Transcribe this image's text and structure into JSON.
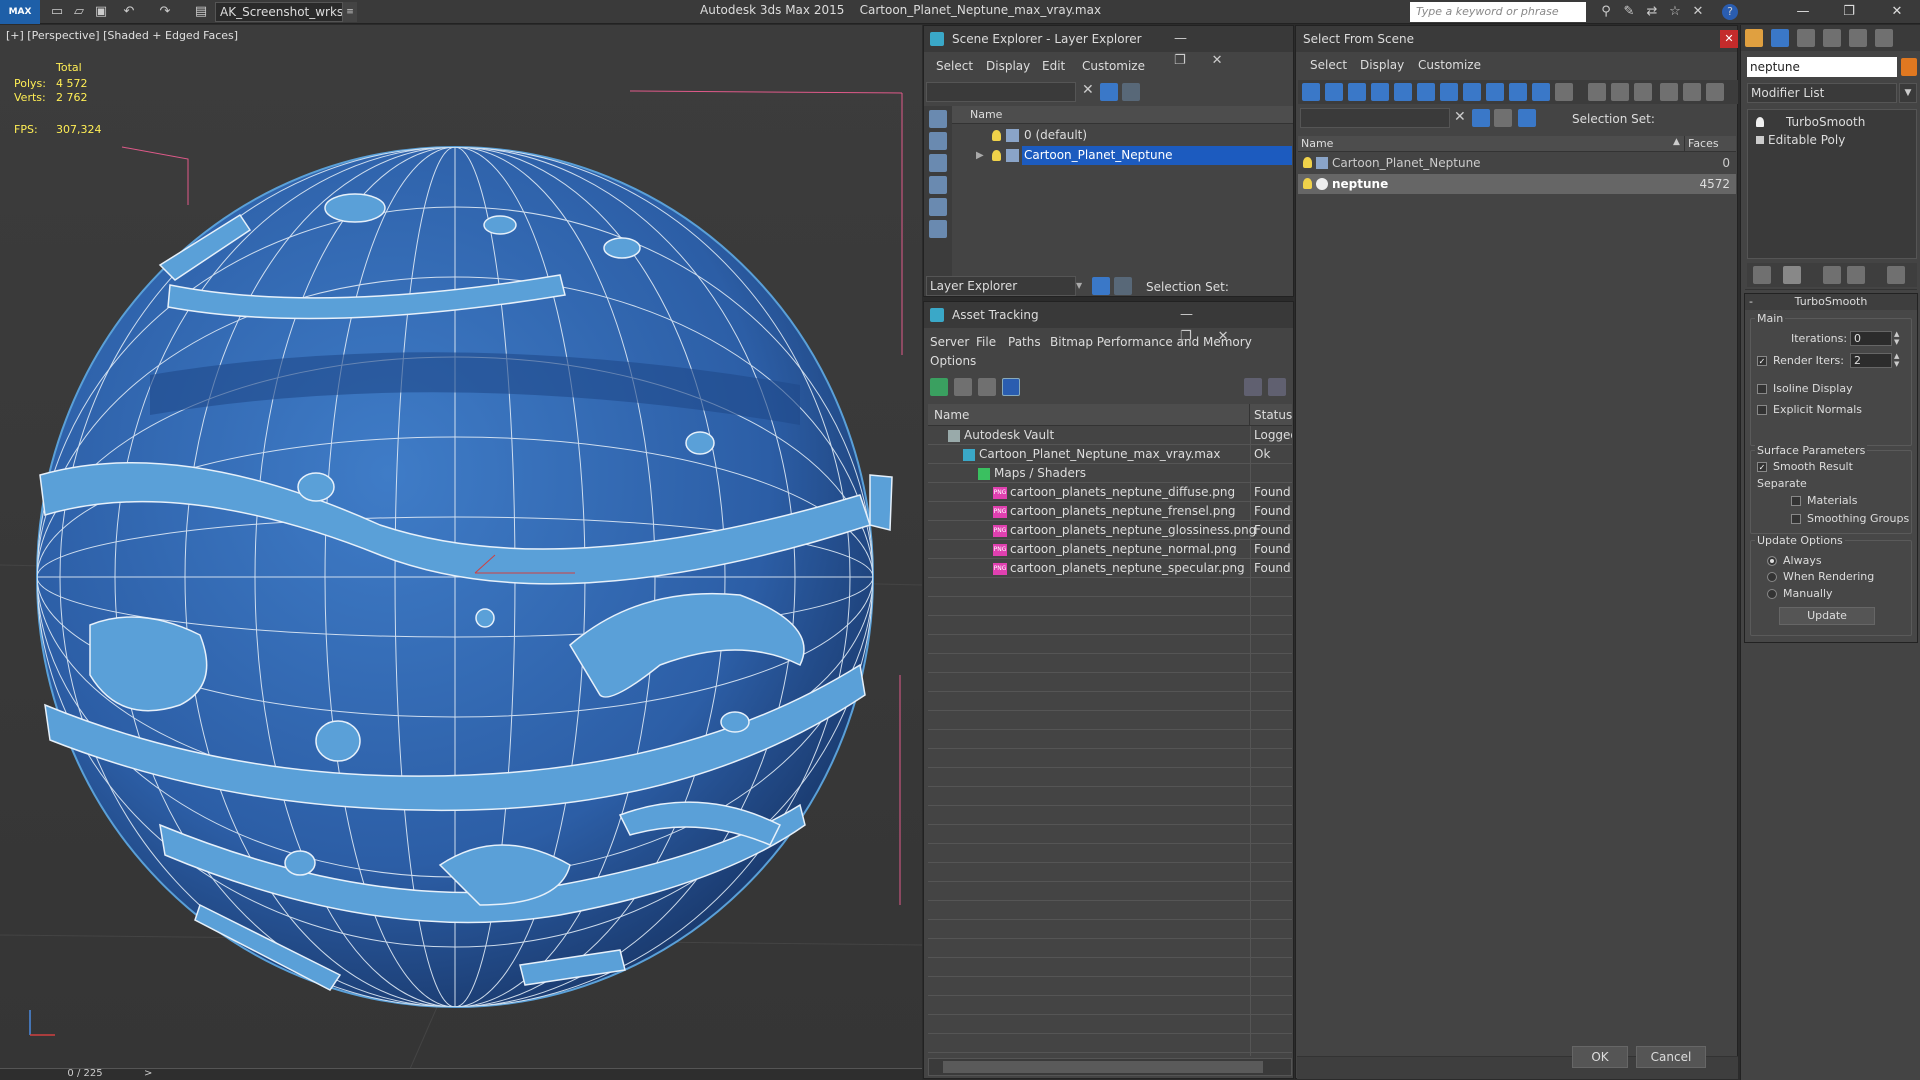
{
  "app": {
    "workspace": "AK_Screenshot_wrksp",
    "app_name": "Autodesk 3ds Max  2015",
    "file_name": "Cartoon_Planet_Neptune_max_vray.max",
    "search_placeholder": "Type a keyword or phrase"
  },
  "viewport": {
    "label": "[+] [Perspective] [Shaded + Edged Faces]",
    "total_label": "Total",
    "polys_label": "Polys:",
    "polys_value": "4 572",
    "verts_label": "Verts:",
    "verts_value": "2 762",
    "fps_label": "FPS:",
    "fps_value": "307,324",
    "timeline": "0 / 225"
  },
  "scene_explorer": {
    "title": "Scene Explorer - Layer Explorer",
    "menu": [
      "Select",
      "Display",
      "Edit",
      "Customize"
    ],
    "col_name": "Name",
    "layers": [
      "0 (default)",
      "Cartoon_Planet_Neptune"
    ],
    "footer_dropdown": "Layer Explorer",
    "selection_set": "Selection Set:"
  },
  "asset_tracking": {
    "title": "Asset Tracking",
    "menu": [
      "Server",
      "File",
      "Paths",
      "Bitmap Performance and Memory",
      "Options"
    ],
    "col_name": "Name",
    "col_status": "Status",
    "rows": [
      {
        "name": "Autodesk Vault",
        "status": "Logged",
        "indent": 0
      },
      {
        "name": "Cartoon_Planet_Neptune_max_vray.max",
        "status": "Ok",
        "indent": 1
      },
      {
        "name": "Maps / Shaders",
        "status": "",
        "indent": 2
      },
      {
        "name": "cartoon_planets_neptune_diffuse.png",
        "status": "Found",
        "indent": 3
      },
      {
        "name": "cartoon_planets_neptune_frensel.png",
        "status": "Found",
        "indent": 3
      },
      {
        "name": "cartoon_planets_neptune_glossiness.png",
        "status": "Found",
        "indent": 3
      },
      {
        "name": "cartoon_planets_neptune_normal.png",
        "status": "Found",
        "indent": 3
      },
      {
        "name": "cartoon_planets_neptune_specular.png",
        "status": "Found",
        "indent": 3
      }
    ]
  },
  "select_from_scene": {
    "title": "Select From Scene",
    "menu": [
      "Select",
      "Display",
      "Customize"
    ],
    "selection_set": "Selection Set:",
    "col_name": "Name",
    "col_faces": "Faces",
    "rows": [
      {
        "name": "Cartoon_Planet_Neptune",
        "faces": "0"
      },
      {
        "name": "neptune",
        "faces": "4572"
      }
    ],
    "ok": "OK",
    "cancel": "Cancel"
  },
  "command_panel": {
    "object_name": "neptune",
    "modifier_list": "Modifier List",
    "stack": [
      "TurboSmooth",
      "Editable Poly"
    ],
    "rollout_title": "TurboSmooth",
    "main_label": "Main",
    "iterations_label": "Iterations:",
    "iterations_value": "0",
    "render_iters_label": "Render Iters:",
    "render_iters_value": "2",
    "isoline_display": "Isoline Display",
    "explicit_normals": "Explicit Normals",
    "surface_params": "Surface Parameters",
    "smooth_result": "Smooth Result",
    "separate": "Separate",
    "materials": "Materials",
    "smoothing_groups": "Smoothing Groups",
    "update_options": "Update Options",
    "always": "Always",
    "when_rendering": "When Rendering",
    "manually": "Manually",
    "update_btn": "Update"
  },
  "colors": {
    "planet": "#2f66ad",
    "rings": "#5aa0d8",
    "selection": "#1c5bbf",
    "stats_yellow": "#ffee55"
  }
}
